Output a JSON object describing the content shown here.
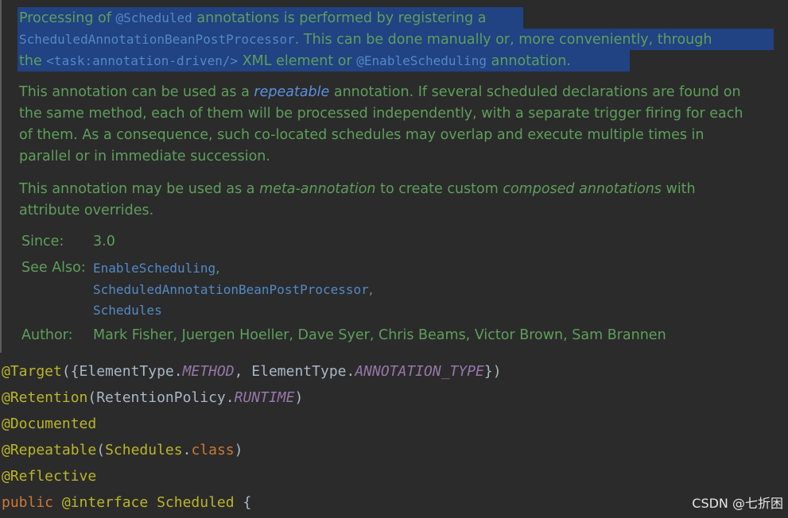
{
  "javadoc": {
    "para1": {
      "line1": {
        "t1": "Processing of ",
        "c1": "@Scheduled",
        "t2": " annotations is performed by registering a"
      },
      "line2": {
        "c1": "ScheduledAnnotationBeanPostProcessor",
        "t1": ". This can be done manually or, more conveniently, through"
      },
      "line3": {
        "t1": "the ",
        "c1": "<task:annotation-driven/>",
        "t2": " XML element or ",
        "c2": "@EnableScheduling",
        "t3": " annotation."
      }
    },
    "para2": {
      "line1": {
        "t1": "This annotation can be used as a ",
        "i1": "repeatable",
        "t2": " annotation. If several scheduled declarations are found on"
      },
      "line2": "the same method, each of them will be processed independently, with a separate trigger firing for each",
      "line3": "of them. As a consequence, such co-located schedules may overlap and execute multiple times in",
      "line4": "parallel or in immediate succession."
    },
    "para3": {
      "line1": {
        "t1": "This annotation may be used as a ",
        "i1": "meta-annotation",
        "t2": " to create custom ",
        "i2": "composed annotations",
        "t3": " with"
      },
      "line2": "attribute overrides."
    },
    "tags": {
      "since_label": "Since:",
      "since_value": "3.0",
      "see_also_label": "See Also:",
      "see_also": [
        "EnableScheduling",
        "ScheduledAnnotationBeanPostProcessor",
        "Schedules"
      ],
      "comma": ",",
      "author_label": "Author:",
      "author_value": "Mark Fisher, Juergen Hoeller, Dave Syer, Chris Beams, Victor Brown, Sam Brannen"
    }
  },
  "code": {
    "l1": {
      "a": "@Target",
      "b": "({ElementType.",
      "c": "METHOD",
      "d": ", ElementType.",
      "e": "ANNOTATION_TYPE",
      "f": "})"
    },
    "l2": {
      "a": "@Retention",
      "b": "(RetentionPolicy.",
      "c": "RUNTIME",
      "d": ")"
    },
    "l3": {
      "a": "@Documented"
    },
    "l4": {
      "a": "@Repeatable",
      "b": "(",
      "c": "Schedules",
      "d": ".",
      "e": "class",
      "f": ")"
    },
    "l5": {
      "a": "@Reflective"
    },
    "l6": {
      "a": "public ",
      "b": "@interface ",
      "c": "Scheduled ",
      "d": "{"
    }
  },
  "watermark": "CSDN @七折困",
  "colors": {
    "background": "#2b2b2b",
    "doc_text": "#5e9f5a",
    "selection": "#214283",
    "link": "#5289c5",
    "annotation": "#bbb529",
    "constant": "#9876aa",
    "keyword": "#cc7832"
  }
}
